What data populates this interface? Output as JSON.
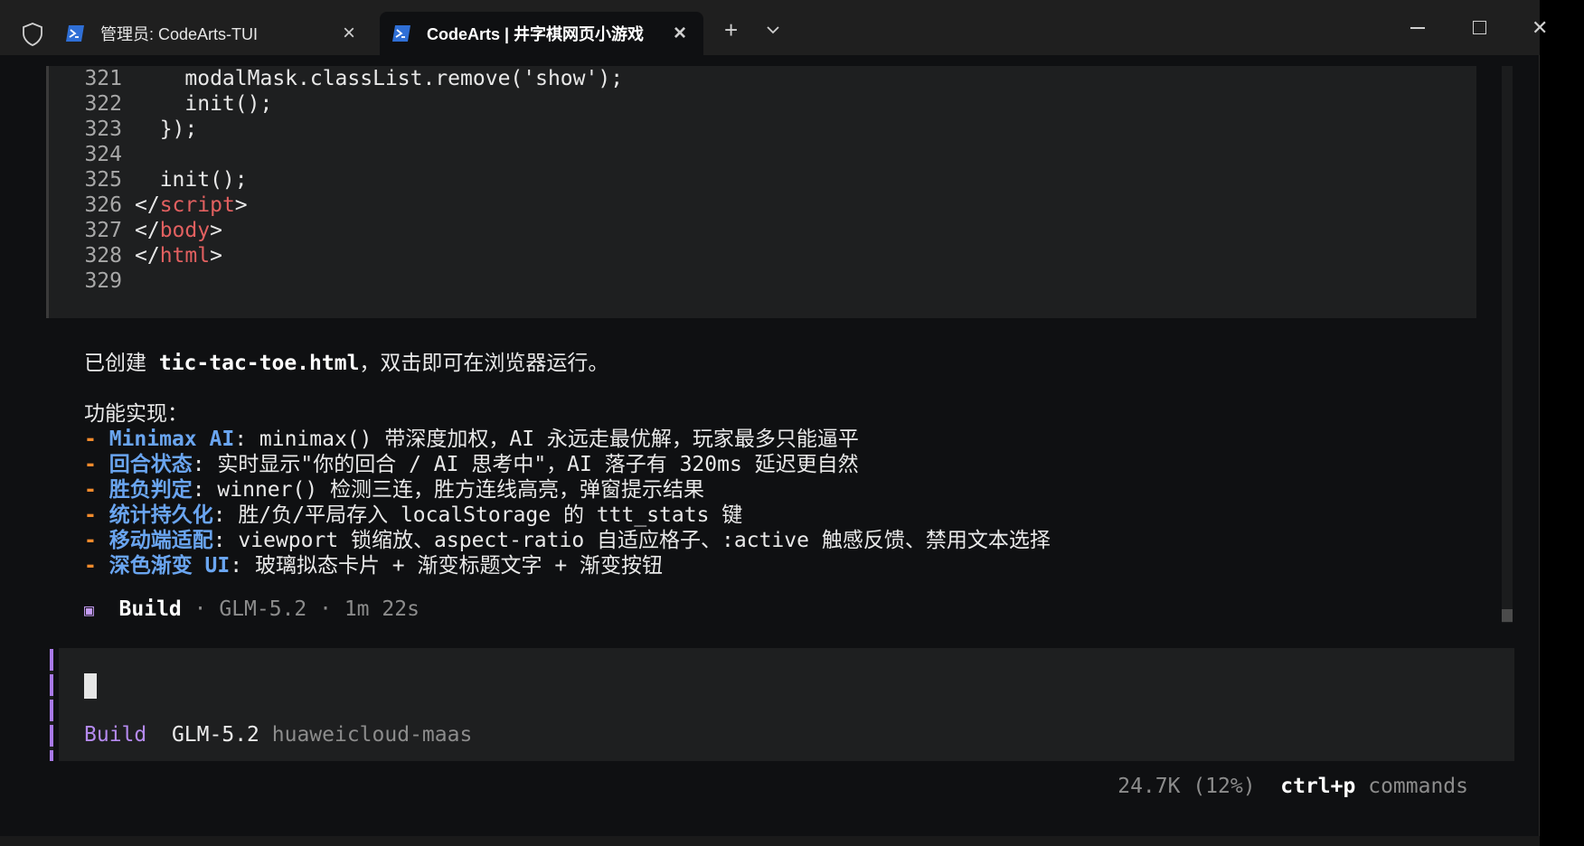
{
  "tabs": [
    {
      "title": "管理员: CodeArts-TUI"
    },
    {
      "title": "CodeArts | 井字棋网页小游戏"
    }
  ],
  "code_lines": [
    {
      "num": "321",
      "text": "    modalMask.classList.remove('show');"
    },
    {
      "num": "322",
      "text": "    init();"
    },
    {
      "num": "323",
      "text": "  });"
    },
    {
      "num": "324",
      "text": ""
    },
    {
      "num": "325",
      "text": "  init();"
    },
    {
      "num": "326",
      "open": "</",
      "tag": "script",
      "close": ">"
    },
    {
      "num": "327",
      "open": "</",
      "tag": "body",
      "close": ">"
    },
    {
      "num": "328",
      "open": "</",
      "tag": "html",
      "close": ">"
    },
    {
      "num": "329",
      "text": ""
    }
  ],
  "response": {
    "created_prefix": "已创建 ",
    "created_file": "tic-tac-toe.html",
    "created_suffix": "，双击即可在浏览器运行。",
    "features_heading": "功能实现：",
    "features": [
      {
        "dash": "- ",
        "key": "Minimax AI",
        "desc": ": minimax() 带深度加权，AI 永远走最优解，玩家最多只能逼平"
      },
      {
        "dash": "- ",
        "key": "回合状态",
        "desc": ": 实时显示\"你的回合 / AI 思考中\"，AI 落子有 320ms 延迟更自然"
      },
      {
        "dash": "- ",
        "key": "胜负判定",
        "desc": ": winner() 检测三连，胜方连线高亮，弹窗提示结果"
      },
      {
        "dash": "- ",
        "key": "统计持久化",
        "desc": ": 胜/负/平局存入 localStorage 的 ttt_stats 键"
      },
      {
        "dash": "- ",
        "key": "移动端适配",
        "desc": ": viewport 锁缩放、aspect-ratio 自适应格子、:active 触感反馈、禁用文本选择"
      },
      {
        "dash": "- ",
        "key": "深色渐变 UI",
        "desc": ": 玻璃拟态卡片 + 渐变标题文字 + 渐变按钮"
      }
    ]
  },
  "build_status": {
    "icon": "▣",
    "agent": "Build",
    "sep": " · ",
    "model": "GLM-5.2",
    "duration": "1m 22s"
  },
  "prompt": {
    "agent": "Build",
    "model": "GLM-5.2",
    "provider": "huaweicloud-maas"
  },
  "status": {
    "tokens": "24.7K (12%)",
    "shortcut": "ctrl+p",
    "shortcut_label": "commands"
  },
  "colors": {
    "accent_purple": "#b58af0",
    "dash_orange": "#f28b2c",
    "keyword_blue": "#6aa5f0",
    "tag_red": "#e26060"
  }
}
